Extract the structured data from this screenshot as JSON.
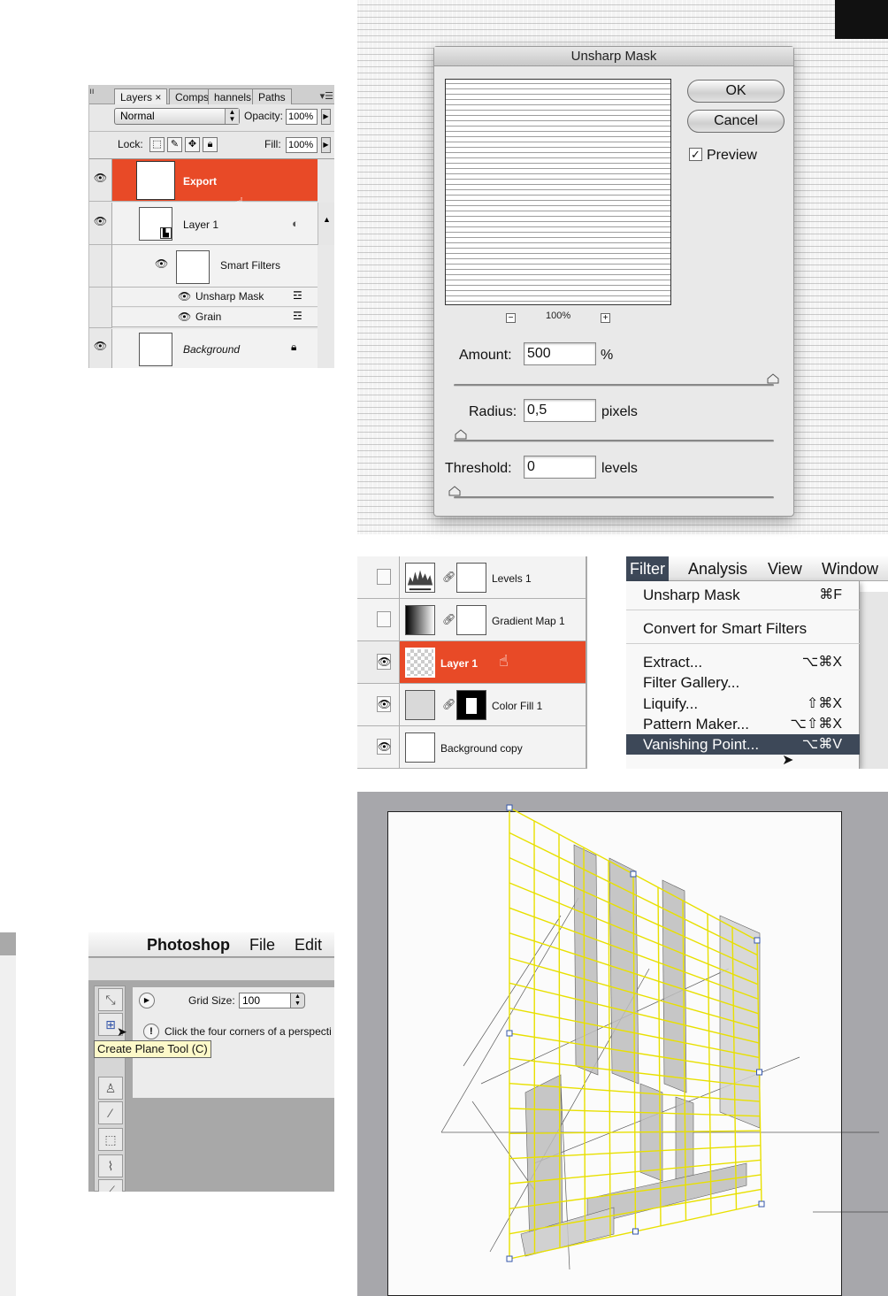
{
  "layers_panel": {
    "tabs": [
      "Layers",
      "Comps",
      "hannels",
      "Paths"
    ],
    "tab_close": "×",
    "blend_mode": "Normal",
    "opacity_label": "Opacity:",
    "opacity_value": "100%",
    "lock_label": "Lock:",
    "fill_label": "Fill:",
    "fill_value": "100%",
    "layers": [
      {
        "name": "Export",
        "selected": true
      },
      {
        "name": "Layer 1"
      },
      {
        "name": "Smart Filters"
      },
      {
        "name": "Unsharp Mask"
      },
      {
        "name": "Grain"
      },
      {
        "name": "Background"
      }
    ],
    "selected_color": "#e84a27"
  },
  "unsharp_dialog": {
    "title": "Unsharp Mask",
    "ok": "OK",
    "cancel": "Cancel",
    "preview_label": "Preview",
    "preview_checked": true,
    "zoom": "100%",
    "amount_label": "Amount:",
    "amount_value": "500",
    "amount_unit": "%",
    "amount_fraction": 1.0,
    "radius_label": "Radius:",
    "radius_value": "0,5",
    "radius_unit": "pixels",
    "radius_fraction": 0.0,
    "threshold_label": "Threshold:",
    "threshold_value": "0",
    "threshold_unit": "levels",
    "threshold_fraction": 0.0
  },
  "layers_panel_2": {
    "layers": [
      {
        "name": "Levels 1",
        "visible": false
      },
      {
        "name": "Gradient Map 1",
        "visible": false
      },
      {
        "name": "Layer 1",
        "visible": true,
        "selected": true
      },
      {
        "name": "Color Fill 1",
        "visible": true
      },
      {
        "name": "Background copy",
        "visible": true
      }
    ]
  },
  "filter_menu": {
    "menubar": [
      "Filter",
      "Analysis",
      "View",
      "Window"
    ],
    "items": [
      {
        "label": "Unsharp Mask",
        "shortcut": "⌘F"
      },
      {
        "label": "Convert for Smart Filters",
        "shortcut": ""
      },
      {
        "label": "Extract...",
        "shortcut": "⌥⌘X"
      },
      {
        "label": "Filter Gallery...",
        "shortcut": ""
      },
      {
        "label": "Liquify...",
        "shortcut": "⇧⌘X"
      },
      {
        "label": "Pattern Maker...",
        "shortcut": "⌥⇧⌘X"
      },
      {
        "label": "Vanishing Point...",
        "shortcut": "⌥⌘V",
        "highlighted": true
      }
    ],
    "highlight_color": "#3d4858"
  },
  "vp_panel": {
    "menubar": [
      "Photoshop",
      "File",
      "Edit"
    ],
    "grid_size_label": "Grid Size:",
    "grid_size_value": "100",
    "hint": "Click the four corners of a perspecti",
    "tooltip": "Create Plane Tool (C)",
    "grid_color": "#e8e000"
  }
}
